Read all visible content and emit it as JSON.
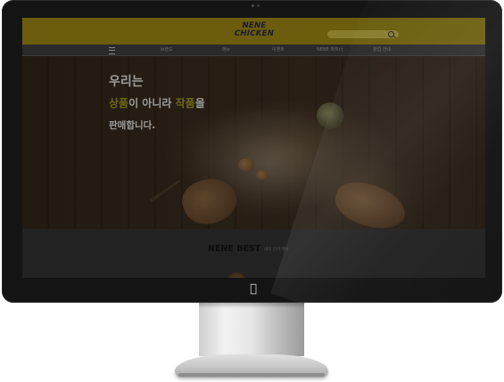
{
  "site": {
    "logo": {
      "line1": "NENE",
      "line2": "CHICKEN"
    },
    "search": {
      "placeholder": ""
    },
    "nav": {
      "items": [
        "브랜드",
        "메뉴",
        "이벤트",
        "NENE 파트너",
        "창업 안내"
      ]
    },
    "hero": {
      "line1": "우리는",
      "line2_highlight1": "상품",
      "line2_middle": "이 아니라 ",
      "line2_highlight2": "작품",
      "line2_end": "을",
      "line3": "판매합니다."
    },
    "best": {
      "title": "NENE BEST",
      "subtitle": "네네 인기 메뉴"
    }
  },
  "colors": {
    "header_bg": "#6b5d0d",
    "highlight_text": "#6e6a14",
    "monitor_bezel": "#141414"
  }
}
